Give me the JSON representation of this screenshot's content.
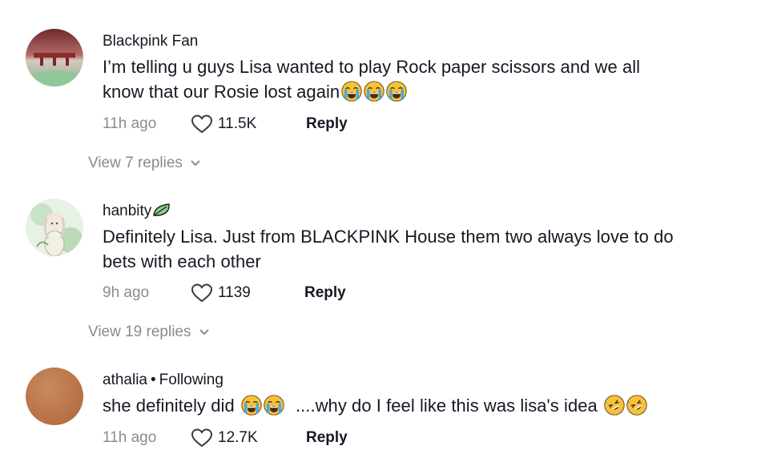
{
  "comments": [
    {
      "username": "Blackpink Fan",
      "text_line1": "I’m telling u guys Lisa wanted to play Rock paper scissors and we all",
      "text_line2": "know that our Rosie lost again",
      "time": "11h ago",
      "likes": "11.5K",
      "reply_label": "Reply",
      "view_replies": "View 7 replies"
    },
    {
      "username": "hanbity",
      "text_line1": "Definitely Lisa. Just from BLACKPINK House them two always love to do",
      "text_line2": "bets with each other",
      "time": "9h ago",
      "likes": "1139",
      "reply_label": "Reply",
      "view_replies": "View 19 replies"
    },
    {
      "username": "athalia",
      "following": "Following",
      "text_part1": "she definitely did",
      "text_part2": "....why do I feel like this was lisa's idea",
      "time": "11h ago",
      "likes": "12.7K",
      "reply_label": "Reply"
    }
  ],
  "icons": {
    "crying_emoji": "loudly-crying-face",
    "rolling_emoji": "rolling-on-floor-laughing-face",
    "heart": "heart-outline-icon",
    "chevron": "chevron-down-icon",
    "leaf": "leaf-icon"
  },
  "colors": {
    "text": "#161823",
    "muted": "#8a8b91",
    "emoji_yellow": "#f7c23a",
    "tear_blue": "#3fa9e8"
  }
}
